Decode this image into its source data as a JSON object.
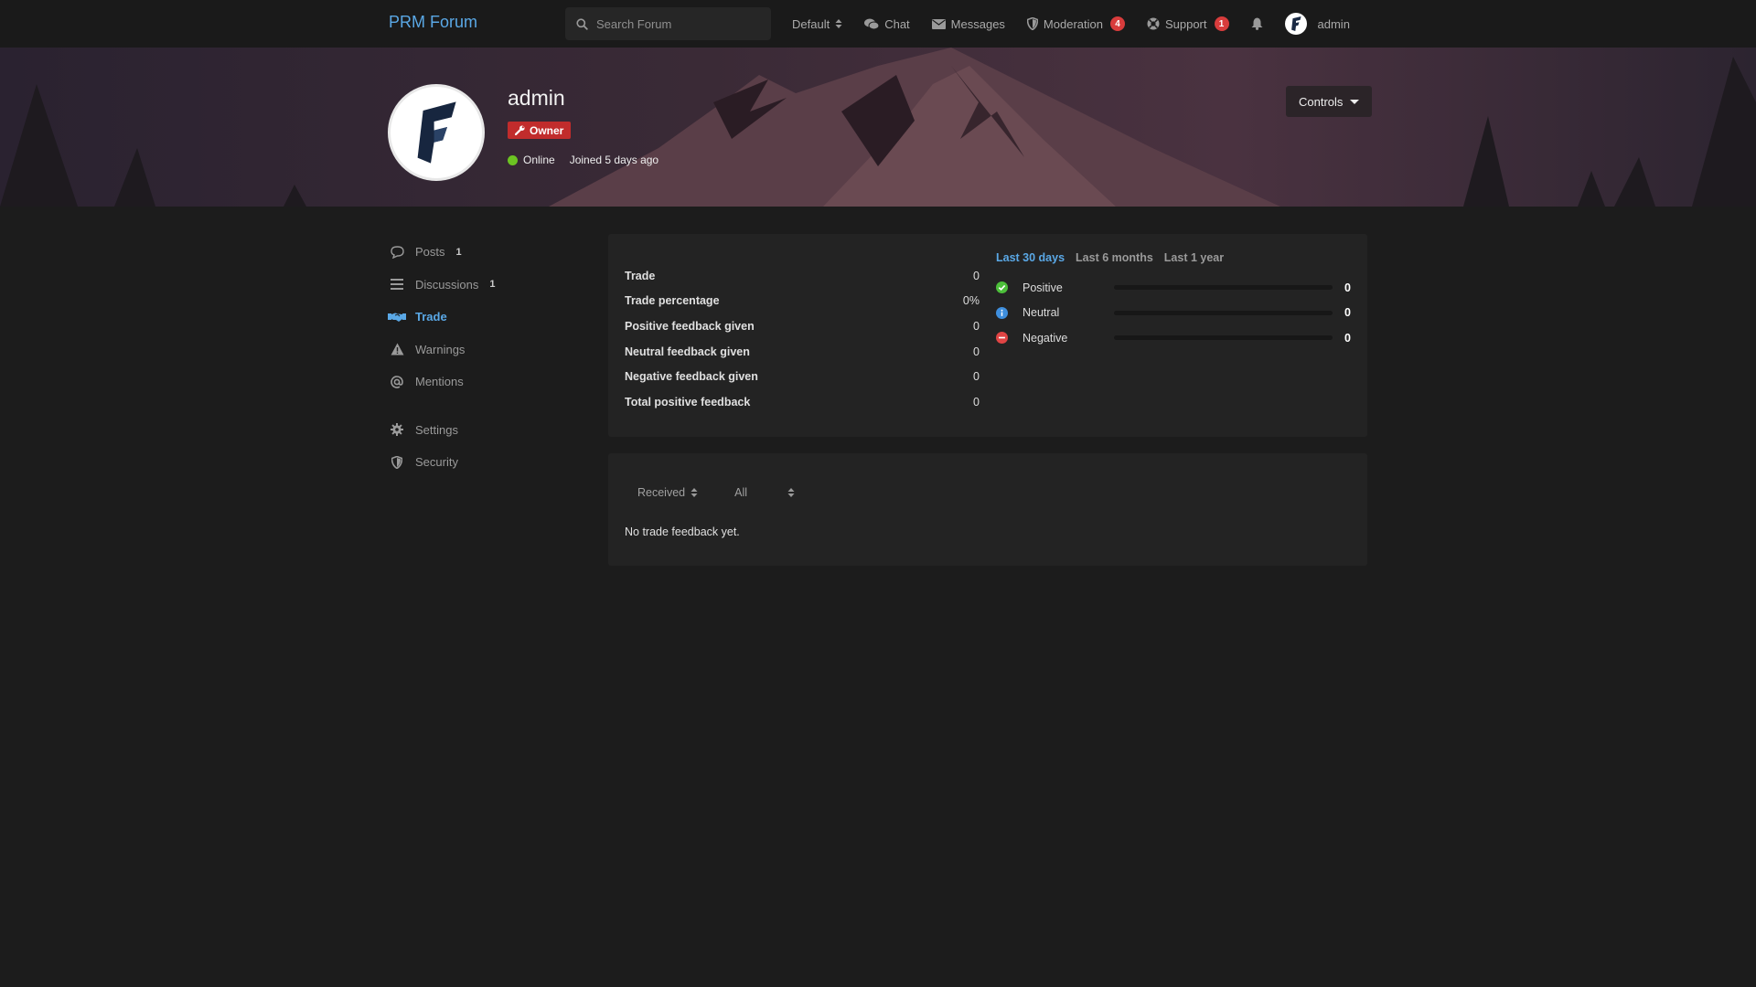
{
  "header": {
    "logo": "PRM Forum",
    "search_placeholder": "Search Forum",
    "nav": {
      "style_select": "Default",
      "chat": "Chat",
      "messages": "Messages",
      "moderation": "Moderation",
      "moderation_count": "4",
      "support": "Support",
      "support_count": "1",
      "username": "admin"
    }
  },
  "profile": {
    "username": "admin",
    "role": "Owner",
    "status": "Online",
    "joined": "Joined 5 days ago",
    "controls_label": "Controls"
  },
  "sidebar": {
    "items": [
      {
        "label": "Posts",
        "count": "1",
        "icon": "comment-icon"
      },
      {
        "label": "Discussions",
        "count": "1",
        "icon": "list-icon"
      },
      {
        "label": "Trade",
        "icon": "handshake-icon",
        "active": true
      },
      {
        "label": "Warnings",
        "icon": "warning-icon"
      },
      {
        "label": "Mentions",
        "icon": "at-icon"
      },
      {
        "label": "Settings",
        "icon": "gear-icon"
      },
      {
        "label": "Security",
        "icon": "shield-icon"
      }
    ]
  },
  "trade_stats": {
    "rows": [
      {
        "label": "Trade",
        "value": "0"
      },
      {
        "label": "Trade percentage",
        "value": "0%"
      },
      {
        "label": "Positive feedback given",
        "value": "0"
      },
      {
        "label": "Neutral feedback given",
        "value": "0"
      },
      {
        "label": "Negative feedback given",
        "value": "0"
      },
      {
        "label": "Total positive feedback",
        "value": "0"
      }
    ],
    "ranges": [
      "Last 30 days",
      "Last 6 months",
      "Last 1 year"
    ],
    "active_range": "Last 30 days",
    "feedback": [
      {
        "label": "Positive",
        "count": "0",
        "fraction": 0,
        "color": "#4cbf3a",
        "icon": "check-circle-icon"
      },
      {
        "label": "Neutral",
        "count": "0",
        "fraction": 0,
        "color": "#3f8fde",
        "icon": "info-circle-icon"
      },
      {
        "label": "Negative",
        "count": "0",
        "fraction": 0,
        "color": "#e04444",
        "icon": "minus-circle-icon"
      }
    ]
  },
  "feedback_list": {
    "direction_select": "Received",
    "type_select": "All",
    "empty_message": "No trade feedback yet."
  },
  "colors": {
    "accent": "#5aa8e6",
    "badge": "#d83c3c",
    "owner_badge": "#c12c2c",
    "online": "#6cc322"
  }
}
